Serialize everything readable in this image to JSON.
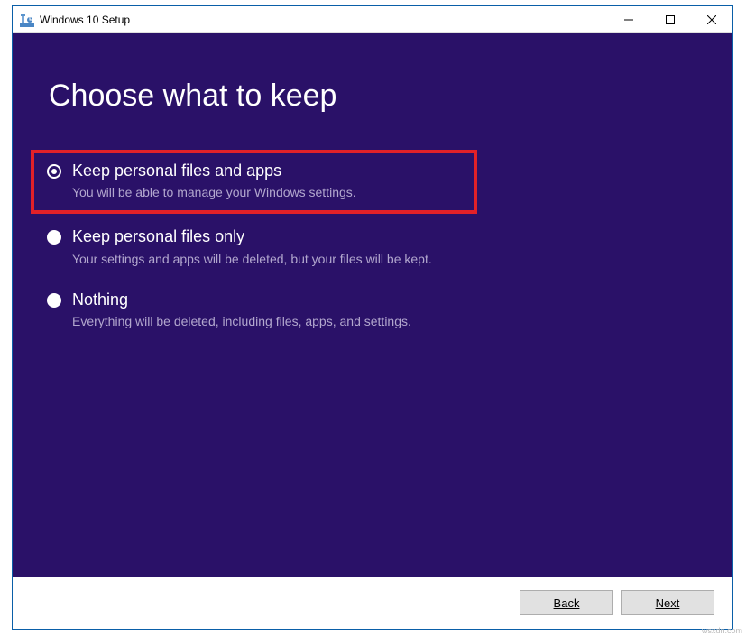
{
  "window": {
    "title": "Windows 10 Setup"
  },
  "heading": "Choose what to keep",
  "options": [
    {
      "title": "Keep personal files and apps",
      "desc": "You will be able to manage your Windows settings."
    },
    {
      "title": "Keep personal files only",
      "desc": "Your settings and apps will be deleted, but your files will be kept."
    },
    {
      "title": "Nothing",
      "desc": "Everything will be deleted, including files, apps, and settings."
    }
  ],
  "footer": {
    "back": "Back",
    "next": "Next"
  },
  "watermark": "wsxdn.com"
}
